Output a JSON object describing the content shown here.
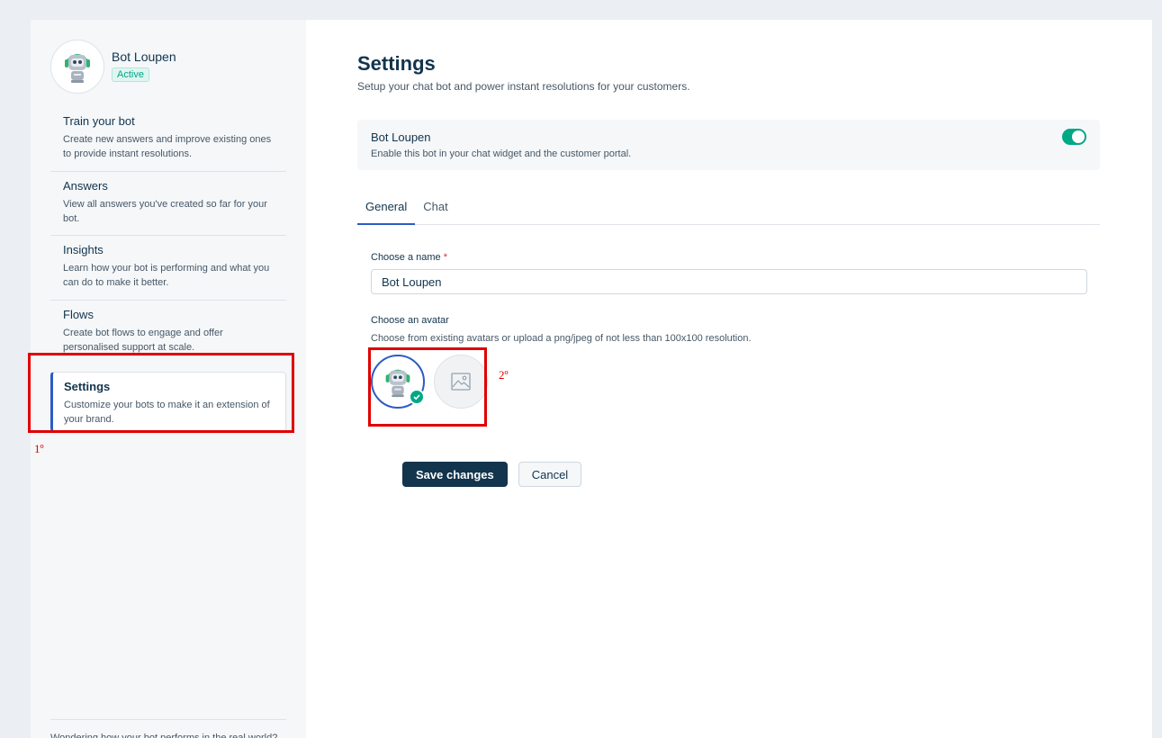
{
  "bot": {
    "name": "Bot Loupen",
    "status": "Active"
  },
  "nav": [
    {
      "title": "Train your bot",
      "desc": "Create new answers and improve existing ones to provide instant resolutions."
    },
    {
      "title": "Answers",
      "desc": "View all answers you've created so far for your bot."
    },
    {
      "title": "Insights",
      "desc": "Learn how your bot is performing and what you can do to make it better."
    },
    {
      "title": "Flows",
      "desc": "Create bot flows to engage and offer personalised support at scale."
    },
    {
      "title": "Settings",
      "desc": "Customize your bots to make it an extension of your brand."
    }
  ],
  "sidebar_footer": "Wondering how your bot performs in the real world?",
  "main": {
    "title": "Settings",
    "subtitle": "Setup your chat bot and power instant resolutions for your customers.",
    "bot_card": {
      "name": "Bot Loupen",
      "hint": "Enable this bot in your chat widget and the customer portal.",
      "enabled": true
    },
    "tabs": [
      "General",
      "Chat"
    ],
    "active_tab": "General",
    "form": {
      "name_label": "Choose a name",
      "required_mark": "*",
      "name_value": "Bot Loupen",
      "avatar_label": "Choose an avatar",
      "avatar_hint": "Choose from existing avatars or upload a png/jpeg of not less than 100x100 resolution."
    },
    "save_label": "Save changes",
    "cancel_label": "Cancel"
  },
  "annotations": {
    "first": "1º",
    "second": "2º"
  },
  "colors": {
    "primary": "#12344d",
    "accent": "#2c5cc5",
    "success": "#00a886",
    "annotation": "#e00000"
  }
}
